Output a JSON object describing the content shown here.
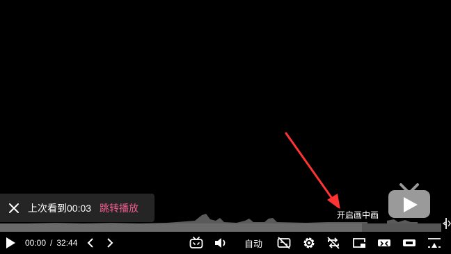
{
  "toast": {
    "message": "上次看到00:03",
    "jump_label": "跳转播放",
    "jump_color": "#f25d8e"
  },
  "tooltip": {
    "pip_label": "开启画中画"
  },
  "time": {
    "current": "00:00",
    "separator": "/",
    "total": "32:44"
  },
  "quality": {
    "label": "自动"
  },
  "progress": {
    "played_fraction": 0.0,
    "buffered_fraction": 0.82
  },
  "icons": {
    "play": "play-icon",
    "prev": "chevron-left-icon",
    "next": "chevron-right-icon",
    "danmaku": "danmaku-icon",
    "volume": "volume-icon",
    "subtitle_off": "subtitle-off-icon",
    "settings": "gear-icon",
    "loop": "loop-off-icon",
    "pip": "pip-icon",
    "widescreen": "widescreen-icon",
    "webfullscreen": "web-fullscreen-icon",
    "fullscreen": "fullscreen-icon",
    "close": "close-icon",
    "tv": "tv-icon"
  },
  "colors": {
    "accent": "#f25d8e",
    "annotation_arrow": "#ff3333",
    "track": "#555555"
  }
}
